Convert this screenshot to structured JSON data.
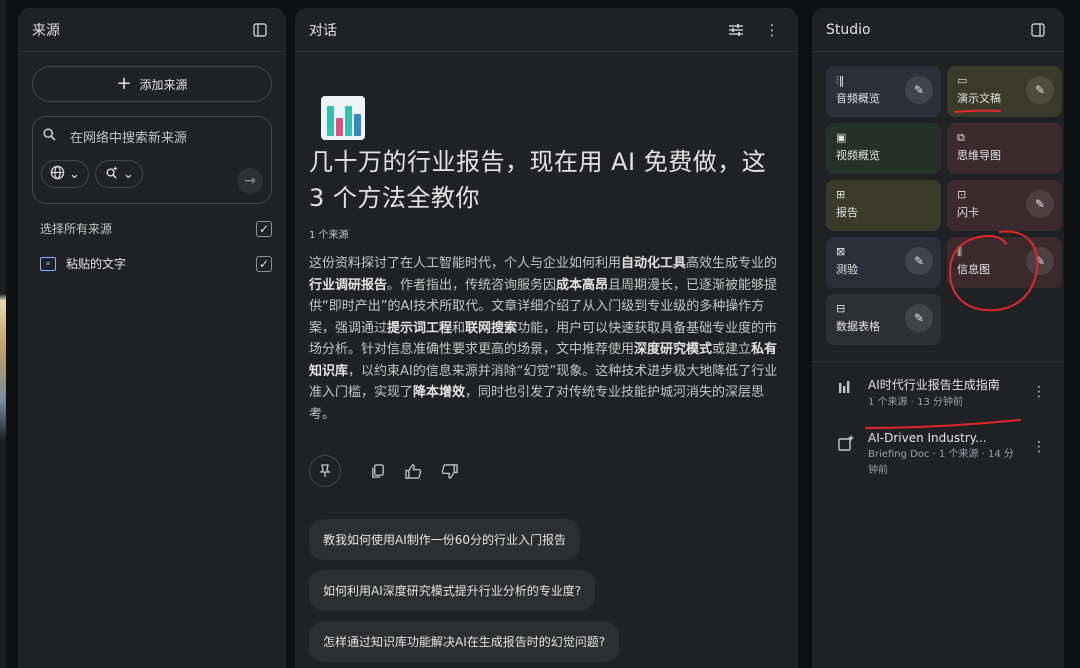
{
  "sources": {
    "title": "来源",
    "add_source_label": "添加来源",
    "search_placeholder": "在网络中搜索新来源",
    "select_all_label": "选择所有来源",
    "items": [
      {
        "label": "粘贴的文字",
        "checked": true
      }
    ]
  },
  "chat": {
    "title": "对话",
    "heading": "几十万的行业报告，现在用 AI 免费做，这 3 个方法全教你",
    "source_count": "1 个来源",
    "summary_parts": [
      {
        "t": "这份资料探讨了在人工智能时代，个人与企业如何利用",
        "b": false
      },
      {
        "t": "自动化工具",
        "b": true
      },
      {
        "t": "高效生成专业的",
        "b": false
      },
      {
        "t": "行业调研报告",
        "b": true
      },
      {
        "t": "。作者指出，传统咨询服务因",
        "b": false
      },
      {
        "t": "成本高昂",
        "b": true
      },
      {
        "t": "且周期漫长，已逐渐被能够提供“即时产出”的AI技术所取代。文章详细介绍了从入门级到专业级的多种操作方案，强调通过",
        "b": false
      },
      {
        "t": "提示词工程",
        "b": true
      },
      {
        "t": "和",
        "b": false
      },
      {
        "t": "联网搜索",
        "b": true
      },
      {
        "t": "功能，用户可以快速获取具备基础专业度的市场分析。针对信息准确性要求更高的场景，文中推荐使用",
        "b": false
      },
      {
        "t": "深度研究模式",
        "b": true
      },
      {
        "t": "或建立",
        "b": false
      },
      {
        "t": "私有知识库",
        "b": true
      },
      {
        "t": "，以约束AI的信息来源并消除“幻觉”现象。这种技术进步极大地降低了行业准入门槛，实现了",
        "b": false
      },
      {
        "t": "降本增效",
        "b": true
      },
      {
        "t": "，同时也引发了对传统专业技能护城河消失的深层思考。",
        "b": false
      }
    ],
    "suggestions": [
      "教我如何使用AI制作一份60分的行业入门报告",
      "如何利用AI深度研究模式提升行业分析的专业度?",
      "怎样通过知识库功能解决AI在生成报告时的幻觉问题?"
    ]
  },
  "studio": {
    "title": "Studio",
    "tiles": [
      {
        "label": "音频概览",
        "icon": "audio-waveform-icon",
        "color": "blue",
        "edit": true
      },
      {
        "label": "演示文稿",
        "icon": "slides-icon",
        "color": "olive",
        "edit": true
      },
      {
        "label": "视频概览",
        "icon": "video-icon",
        "color": "green",
        "edit": false
      },
      {
        "label": "思维导图",
        "icon": "mindmap-icon",
        "color": "maroon",
        "edit": false
      },
      {
        "label": "报告",
        "icon": "report-icon",
        "color": "olive",
        "edit": false
      },
      {
        "label": "闪卡",
        "icon": "flashcard-icon",
        "color": "maroon",
        "edit": true
      },
      {
        "label": "测验",
        "icon": "quiz-icon",
        "color": "blue",
        "edit": true
      },
      {
        "label": "信息图",
        "icon": "infographic-icon",
        "color": "maroon",
        "edit": true
      },
      {
        "label": "数据表格",
        "icon": "table-icon",
        "color": "gray",
        "edit": true
      }
    ],
    "notes": [
      {
        "title": "AI时代行业报告生成指南",
        "meta": "1 个来源 · 13 分钟前",
        "icon": "bar-chart-icon"
      },
      {
        "title": "AI-Driven Industry...",
        "meta": "Briefing Doc · 1 个来源 · 14 分钟前",
        "icon": "note-add-icon"
      }
    ]
  }
}
